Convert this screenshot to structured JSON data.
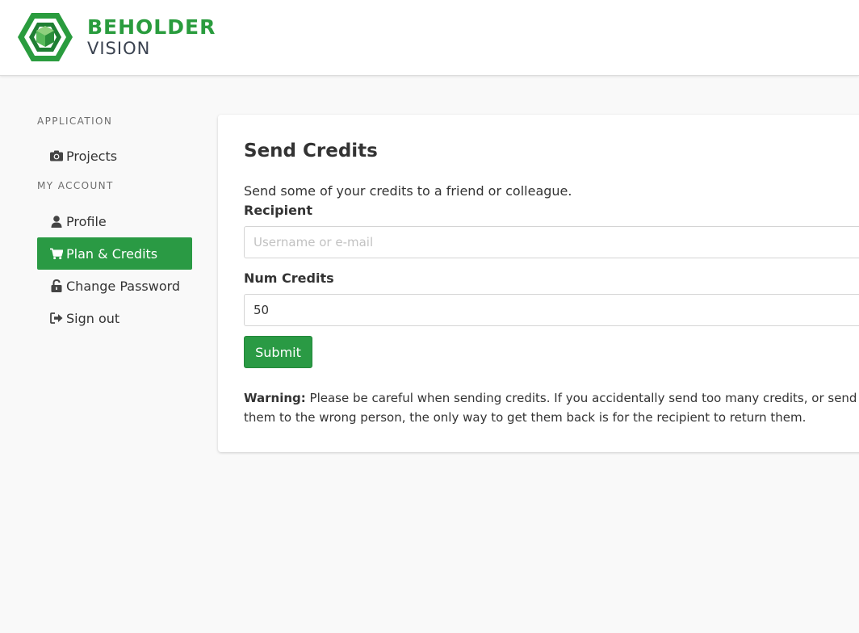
{
  "brand": {
    "line1": "BEHOLDER",
    "line2": "VISION",
    "colors": {
      "primary": "#2a9c3e",
      "dark": "#3a4250"
    }
  },
  "sidebar": {
    "sections": [
      {
        "heading": "APPLICATION"
      },
      {
        "heading": "MY ACCOUNT"
      }
    ],
    "items": [
      {
        "label": "Projects",
        "icon": "camera-icon"
      },
      {
        "label": "Profile",
        "icon": "user-icon"
      },
      {
        "label": "Plan & Credits",
        "icon": "cart-icon",
        "active": true
      },
      {
        "label": "Change Password",
        "icon": "unlock-icon"
      },
      {
        "label": "Sign out",
        "icon": "sign-out-icon"
      }
    ]
  },
  "card": {
    "title": "Send Credits",
    "description": "Send some of your credits to a friend or colleague.",
    "recipient": {
      "label": "Recipient",
      "placeholder": "Username or e-mail",
      "value": ""
    },
    "num_credits": {
      "label": "Num Credits",
      "value": "50"
    },
    "submit_label": "Submit",
    "warning": {
      "prefix": "Warning:",
      "text": " Please be careful when sending credits. If you accidentally send too many credits, or send them to the wrong person, the only way to get them back is for the recipient to return them."
    }
  },
  "colors": {
    "accent": "#2a9a44",
    "background": "#f9f9f9"
  }
}
